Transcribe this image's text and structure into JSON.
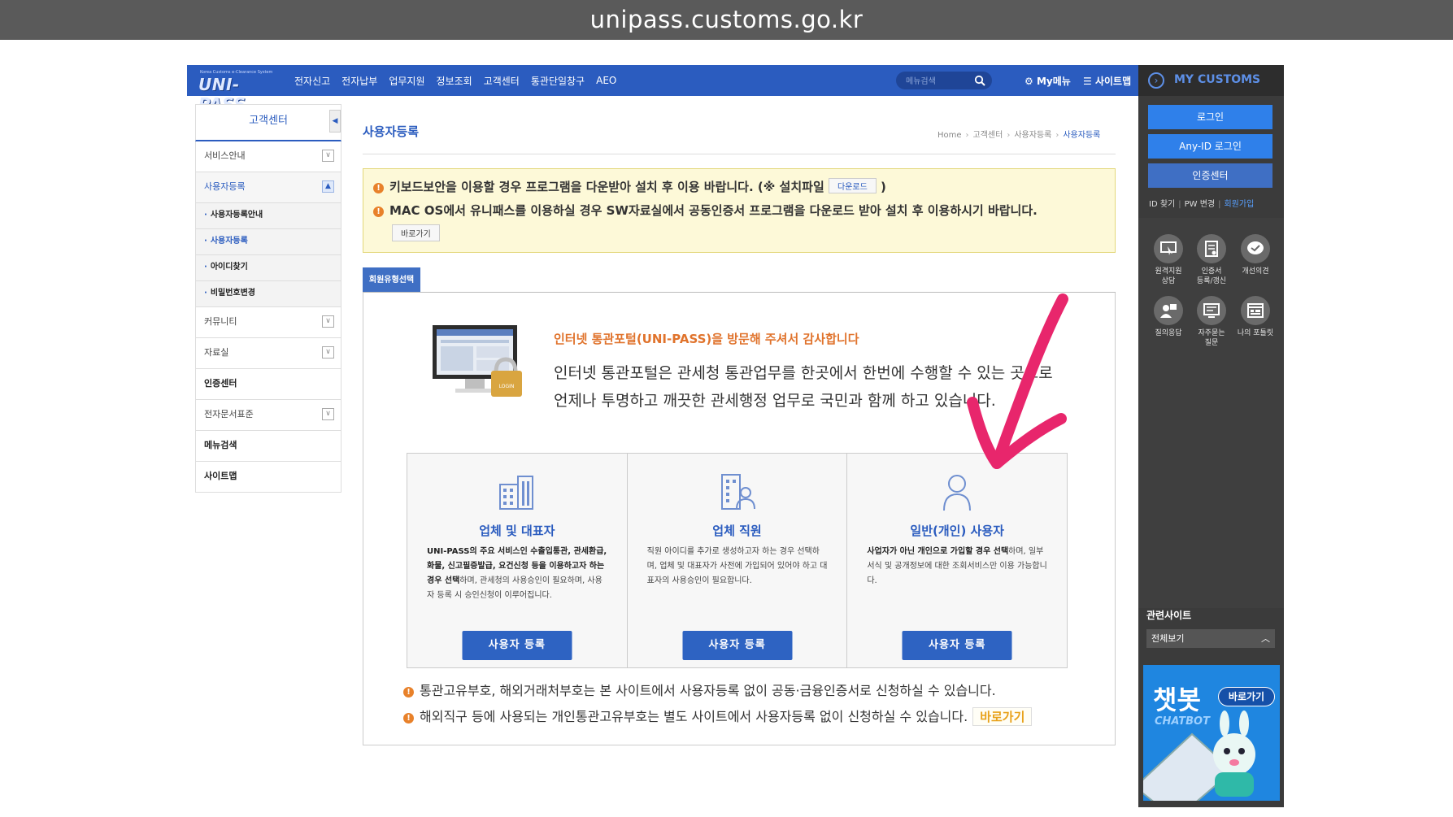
{
  "browser": {
    "url": "unipass.customs.go.kr"
  },
  "header": {
    "logo_tagline": "Korea Customs e-Clearance System",
    "logo_text": "UNI-PASS",
    "menu": [
      "전자신고",
      "전자납부",
      "업무지원",
      "정보조회",
      "고객센터",
      "통관단일창구",
      "AEO"
    ],
    "search_placeholder": "메뉴검색",
    "my_menu": "My메뉴",
    "sitemap": "사이트맵"
  },
  "right_panel": {
    "title": "MY CUSTOMS",
    "login": "로그인",
    "anyid_login": "Any-ID 로그인",
    "cert_center": "인증센터",
    "find_id": "ID 찾기",
    "change_pw": "PW 변경",
    "join": "회원가입",
    "services": [
      {
        "line1": "원격지원",
        "line2": "상담",
        "icon": "remote-support-icon"
      },
      {
        "line1": "인증서",
        "line2": "등록/갱신",
        "icon": "certificate-icon"
      },
      {
        "line1": "개선의견",
        "line2": "",
        "icon": "feedback-icon"
      },
      {
        "line1": "질의응답",
        "line2": "",
        "icon": "qna-icon"
      },
      {
        "line1": "자주묻는",
        "line2": "질문",
        "icon": "faq-icon"
      },
      {
        "line1": "나의 포틀릿",
        "line2": "",
        "icon": "portlet-icon"
      }
    ],
    "related_sites": "관련사이트",
    "related_select": "전체보기",
    "chatbot_title": "챗봇",
    "chatbot_sub": "CHATBOT",
    "chatbot_go": "바로가기"
  },
  "sidebar": {
    "title": "고객센터",
    "items": [
      "서비스안내",
      "사용자등록",
      "커뮤니티",
      "자료실",
      "인증센터",
      "전자문서표준",
      "메뉴검색",
      "사이트맵"
    ],
    "subitems": [
      "사용자등록안내",
      "사용자등록",
      "아이디찾기",
      "비밀번호변경"
    ]
  },
  "main": {
    "title": "사용자등록",
    "breadcrumb": [
      "Home",
      "고객센터",
      "사용자등록",
      "사용자등록"
    ],
    "notice1_pre": "키보드보안을 이용할 경우 프로그램을 다운받아 설치 후 이용 바랍니다. (※ 설치파일",
    "notice1_btn": "다운로드",
    "notice1_post": ")",
    "notice2": "MAC OS에서 유니패스를 이용하실 경우 SW자료실에서 공동인증서 프로그램을 다운로드 받아 설치 후 이용하시기 바랍니다.",
    "notice2_btn": "바로가기",
    "tab": "회원유형선택",
    "intro_title": "인터넷 통관포털(UNI-PASS)을 방문해 주셔서 감사합니다",
    "intro_line1": "인터넷 통관포털은 관세청 통관업무를 한곳에서 한번에 수행할 수 있는 곳으로",
    "intro_line2": "언제나 투명하고 깨끗한 관세행정 업무로 국민과 함께 하고 있습니다.",
    "monitor_lock": "LOGIN",
    "types": [
      {
        "name": "업체 및 대표자",
        "desc_bold": "UNI-PASS의 주요 서비스인 수출입통관, 관세환급, 화물, 신고필증발급, 요건신청 등을 이용하고자 하는 경우 선택",
        "desc": "하며, 관세청의 사용승인이 필요하며, 사용자 등록 시 승인신청이 이루어집니다.",
        "button": "사용자 등록"
      },
      {
        "name": "업체 직원",
        "desc_bold": "",
        "desc": "직원 아이디를 추가로 생성하고자 하는 경우 선택하며, 업체 및 대표자가 사전에 가입되어 있어야 하고 대표자의 사용승인이 필요합니다.",
        "button": "사용자 등록"
      },
      {
        "name": "일반(개인) 사용자",
        "desc_bold": "사업자가 아닌 개인으로 가입할 경우 선택",
        "desc": "하며, 일부서식 및 공개정보에 대한 조회서비스만 이용 가능합니다.",
        "button": "사용자 등록"
      }
    ],
    "note1": "통관고유부호, 해외거래처부호는 본 사이트에서 사용자등록 없이 공동·금융인증서로 신청하실 수 있습니다.",
    "note2": "해외직구 등에 사용되는 개인통관고유부호는 별도 사이트에서 사용자등록 없이 신청하실 수 있습니다.",
    "note2_btn": "바로가기"
  },
  "colors": {
    "brand_blue": "#2b5cbf",
    "accent_orange": "#e0732c",
    "annotation_pink": "#e8266c"
  }
}
